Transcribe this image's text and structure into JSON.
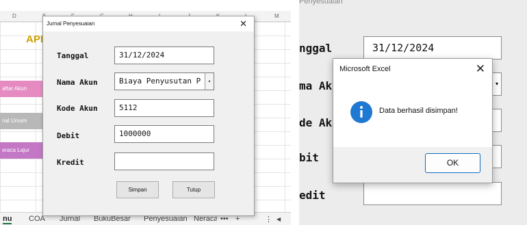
{
  "left": {
    "column_headers": [
      "D",
      "E",
      "F",
      "G",
      "H",
      "I",
      "J",
      "K",
      "L",
      "M"
    ],
    "app_title": "API",
    "sidebar_buttons": [
      "aftar Akun",
      "nal Umum",
      "eraca Lajur"
    ],
    "sheet_tabs": [
      "nu",
      "COA",
      "Jurnal",
      "BukuBesar",
      "Penyesuaian",
      "Neraca"
    ],
    "tab_icons": {
      "more": "•••",
      "add": "+",
      "vmore": "⋮",
      "scroll_left": "◀"
    },
    "userform": {
      "title": "Jurnal Penyesuaian",
      "close": "✕",
      "fields": [
        {
          "label": "Tanggal",
          "value": "31/12/2024"
        },
        {
          "label": "Nama Akun",
          "value": "Biaya Penyusutan P"
        },
        {
          "label": "Kode Akun",
          "value": "5112"
        },
        {
          "label": "Debit",
          "value": "1000000"
        },
        {
          "label": "Kredit",
          "value": ""
        }
      ],
      "combo_arrow": "▾",
      "buttons": {
        "save": "Simpan",
        "close": "Tutup"
      }
    }
  },
  "right": {
    "prev_text": "Penyesuaian",
    "labels": [
      "nggal",
      "ma Aku",
      "de Aku",
      "bit",
      "edit"
    ],
    "tanggal_value": "31/12/2024",
    "combo_arrow": "▾",
    "msgbox": {
      "title": "Microsoft Excel",
      "close": "✕",
      "icon_glyph": "i",
      "message": "Data berhasil disimpan!",
      "ok": "OK"
    }
  },
  "colors": {
    "info_icon": "#1f78d1",
    "api_title": "#c9a200",
    "sidebar_pink": "#e58bc2",
    "sidebar_gray": "#b8b8b8",
    "sidebar_purple": "#c377c5",
    "ok_border": "#0f6cbd"
  }
}
